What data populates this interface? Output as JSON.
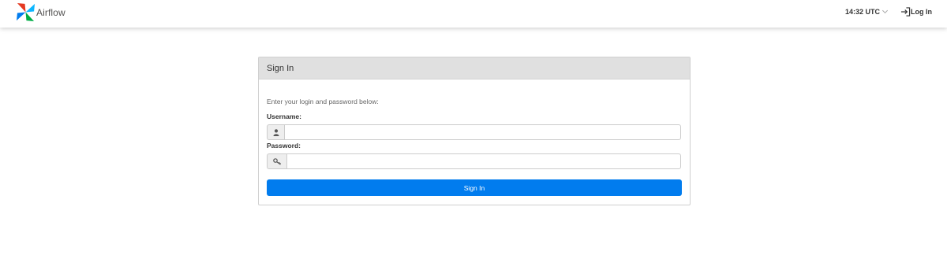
{
  "navbar": {
    "brand_text": "Airflow",
    "logo_icon": "airflow-pinwheel-icon",
    "clock": "14:32 UTC",
    "clock_icon": "chevron-down-icon",
    "login_label": "Log In",
    "login_icon": "login-icon"
  },
  "panel": {
    "heading": "Sign In",
    "hint": "Enter your login and password below:",
    "username_label": "Username:",
    "username_value": "",
    "username_icon": "user-icon",
    "password_label": "Password:",
    "password_value": "",
    "password_icon": "key-icon",
    "submit_label": "Sign In"
  },
  "colors": {
    "primary_button": "#017cee",
    "panel_heading_bg": "#e0e0e0",
    "logo_red": "#e43921",
    "logo_blue": "#0cb6ff",
    "logo_green": "#00ad46",
    "logo_navy": "#017cee"
  }
}
